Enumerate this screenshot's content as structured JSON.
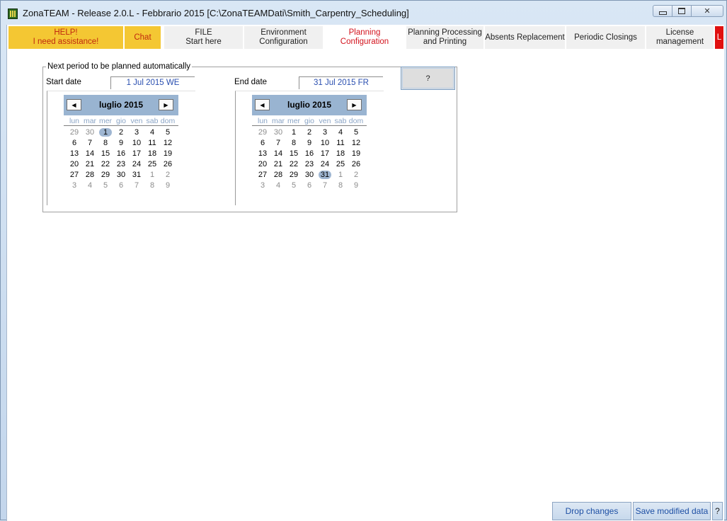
{
  "window": {
    "title": "ZonaTEAM - Release 2.0.L - Febbrario 2015 [C:\\ZonaTEAMDati\\Smith_Carpentry_Scheduling]"
  },
  "tabs": [
    {
      "line1": "HELP!",
      "line2": "I need assistance!"
    },
    {
      "line1": "Chat",
      "line2": ""
    },
    {
      "line1": "FILE",
      "line2": "Start here"
    },
    {
      "line1": "Environment",
      "line2": "Configuration"
    },
    {
      "line1": "Planning Configuration",
      "line2": ""
    },
    {
      "line1": "Planning Processing",
      "line2": "and Printing"
    },
    {
      "line1": "Absents Replacement",
      "line2": ""
    },
    {
      "line1": "Periodic Closings",
      "line2": ""
    },
    {
      "line1": "License",
      "line2": "management"
    },
    {
      "line1": "L",
      "line2": ""
    }
  ],
  "period": {
    "legend": "Next period to be planned automatically",
    "start_label": "Start date",
    "start_value": "1 Jul 2015 WE",
    "end_label": "End date",
    "end_value": "31 Jul 2015 FR",
    "help_button": "?"
  },
  "calendar": {
    "month_title": "luglio 2015",
    "weekdays": [
      "lun",
      "mar",
      "mer",
      "gio",
      "ven",
      "sab",
      "dom"
    ],
    "weeks": [
      [
        "29",
        "30",
        "1",
        "2",
        "3",
        "4",
        "5"
      ],
      [
        "6",
        "7",
        "8",
        "9",
        "10",
        "11",
        "12"
      ],
      [
        "13",
        "14",
        "15",
        "16",
        "17",
        "18",
        "19"
      ],
      [
        "20",
        "21",
        "22",
        "23",
        "24",
        "25",
        "26"
      ],
      [
        "27",
        "28",
        "29",
        "30",
        "31",
        "1",
        "2"
      ],
      [
        "3",
        "4",
        "5",
        "6",
        "7",
        "8",
        "9"
      ]
    ],
    "start_selected": "1",
    "end_selected": "31",
    "prev_glyph": "◀",
    "next_glyph": "▶"
  },
  "footer": {
    "drop_label": "Drop changes",
    "save_label": "Save modified data",
    "help_label": "?"
  },
  "colors": {
    "help_tab": "#f4c733",
    "active_tab_text": "#d3131d",
    "calendar_header": "#99b4d1",
    "date_value": "#2a4fb0"
  }
}
